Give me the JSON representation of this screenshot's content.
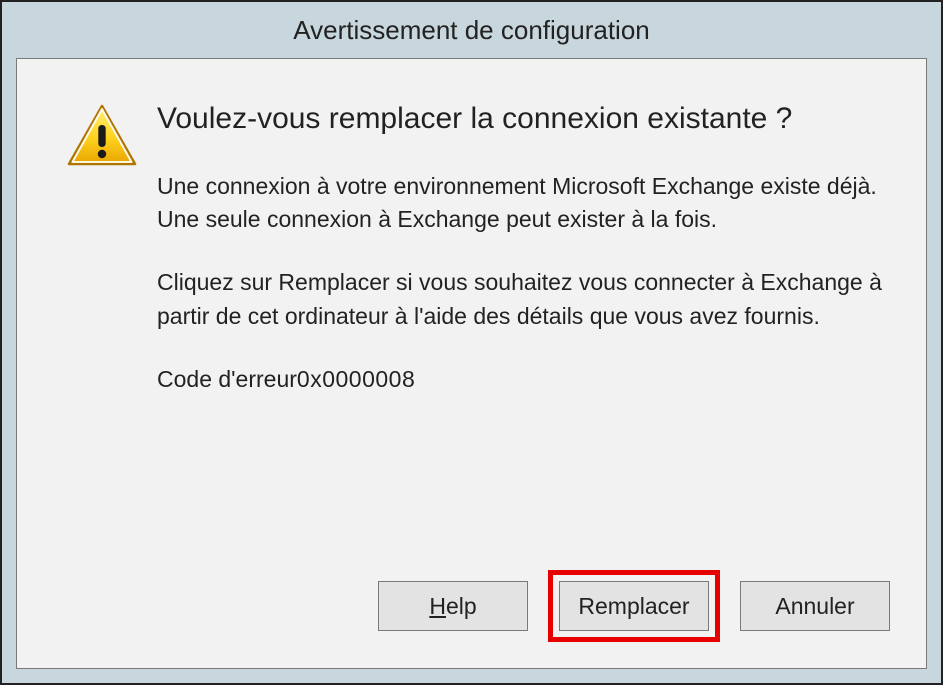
{
  "title": "Avertissement de configuration",
  "heading": "Voulez-vous remplacer la connexion existante ?",
  "body_para1": "Une connexion à votre environnement Microsoft Exchange existe déjà. Une seule connexion à Exchange peut exister à la fois.",
  "body_para2": "Cliquez sur Remplacer si vous souhaitez vous connecter à Exchange à partir de cet ordinateur à l'aide des détails que vous avez fournis.",
  "error_label": "Code d'erreur",
  "error_code": "0x0000008",
  "buttons": {
    "help": "Help",
    "help_mnemonic": "H",
    "replace": "Remplacer",
    "cancel": "Annuler"
  },
  "icon": "warning-icon"
}
